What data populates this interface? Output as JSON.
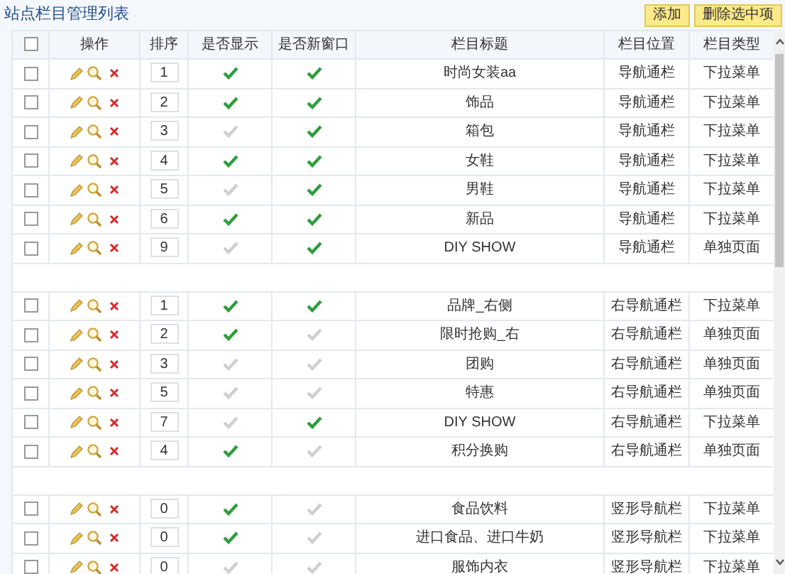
{
  "title": "站点栏目管理列表",
  "buttons": [
    "添加",
    "删除选中项"
  ],
  "select_all_checked": false,
  "columns": [
    "操作",
    "排序",
    "是否显示",
    "是否新窗口",
    "栏目标题",
    "栏目位置",
    "栏目类型"
  ],
  "groups": [
    {
      "rows": [
        {
          "checked": false,
          "order": "1",
          "shown": true,
          "new_window": true,
          "title": "时尚女装aa",
          "position": "导航通栏",
          "type": "下拉菜单"
        },
        {
          "checked": false,
          "order": "2",
          "shown": true,
          "new_window": true,
          "title": "饰品",
          "position": "导航通栏",
          "type": "下拉菜单"
        },
        {
          "checked": false,
          "order": "3",
          "shown": false,
          "new_window": true,
          "title": "箱包",
          "position": "导航通栏",
          "type": "下拉菜单"
        },
        {
          "checked": false,
          "order": "4",
          "shown": true,
          "new_window": true,
          "title": "女鞋",
          "position": "导航通栏",
          "type": "下拉菜单"
        },
        {
          "checked": false,
          "order": "5",
          "shown": false,
          "new_window": true,
          "title": "男鞋",
          "position": "导航通栏",
          "type": "下拉菜单"
        },
        {
          "checked": false,
          "order": "6",
          "shown": true,
          "new_window": true,
          "title": "新品",
          "position": "导航通栏",
          "type": "下拉菜单"
        },
        {
          "checked": false,
          "order": "9",
          "shown": false,
          "new_window": true,
          "title": "DIY SHOW",
          "position": "导航通栏",
          "type": "单独页面"
        }
      ]
    },
    {
      "rows": [
        {
          "checked": false,
          "order": "1",
          "shown": true,
          "new_window": true,
          "title": "品牌_右侧",
          "position": "右导航通栏",
          "type": "下拉菜单"
        },
        {
          "checked": false,
          "order": "2",
          "shown": true,
          "new_window": false,
          "title": "限时抢购_右",
          "position": "右导航通栏",
          "type": "单独页面"
        },
        {
          "checked": false,
          "order": "3",
          "shown": false,
          "new_window": false,
          "title": "团购",
          "position": "右导航通栏",
          "type": "单独页面"
        },
        {
          "checked": false,
          "order": "5",
          "shown": false,
          "new_window": false,
          "title": "特惠",
          "position": "右导航通栏",
          "type": "单独页面"
        },
        {
          "checked": false,
          "order": "7",
          "shown": false,
          "new_window": true,
          "title": "DIY SHOW",
          "position": "右导航通栏",
          "type": "下拉菜单"
        },
        {
          "checked": false,
          "order": "4",
          "shown": true,
          "new_window": false,
          "title": "积分换购",
          "position": "右导航通栏",
          "type": "单独页面"
        }
      ]
    },
    {
      "rows": [
        {
          "checked": false,
          "order": "0",
          "shown": true,
          "new_window": false,
          "title": "食品饮料",
          "position": "竖形导航栏",
          "type": "下拉菜单"
        },
        {
          "checked": false,
          "order": "0",
          "shown": true,
          "new_window": false,
          "title": "进口食品、进口牛奶",
          "position": "竖形导航栏",
          "type": "下拉菜单"
        },
        {
          "checked": false,
          "order": "0",
          "shown": false,
          "new_window": false,
          "title": "服饰内衣",
          "position": "竖形导航栏",
          "type": "下拉菜单"
        }
      ]
    }
  ]
}
